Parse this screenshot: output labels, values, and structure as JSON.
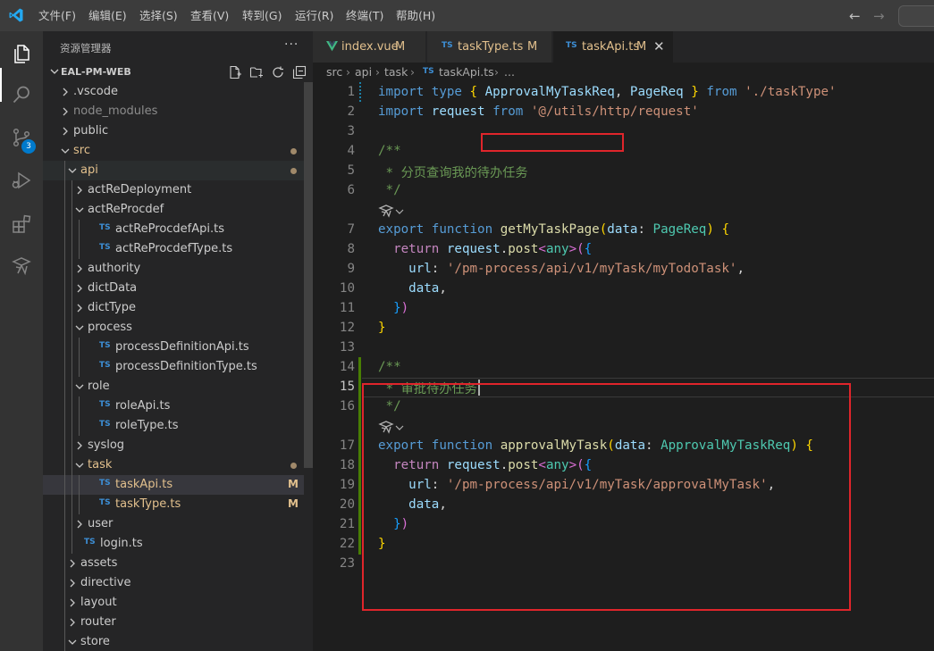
{
  "menu": [
    "文件(F)",
    "编辑(E)",
    "选择(S)",
    "查看(V)",
    "转到(G)",
    "运行(R)",
    "终端(T)",
    "帮助(H)"
  ],
  "activity_bar": {
    "icons": [
      "explorer-icon",
      "search-icon",
      "source-control-icon",
      "run-debug-icon",
      "extensions-icon",
      "vite-icon"
    ],
    "scm_badge": "3"
  },
  "sidebar": {
    "title": "资源管理器",
    "more": "···",
    "workspace": "EAL-PM-WEB",
    "tree": [
      {
        "label": ".vscode",
        "depth": 0,
        "type": "folder",
        "expanded": false
      },
      {
        "label": "node_modules",
        "depth": 0,
        "type": "folder",
        "expanded": false,
        "dim": true
      },
      {
        "label": "public",
        "depth": 0,
        "type": "folder",
        "expanded": false
      },
      {
        "label": "src",
        "depth": 0,
        "type": "folder",
        "expanded": true,
        "modified": true,
        "dot": true
      },
      {
        "label": "api",
        "depth": 1,
        "type": "folder",
        "expanded": true,
        "modified": true,
        "dot": true,
        "highlight": true
      },
      {
        "label": "actReDeployment",
        "depth": 2,
        "type": "folder",
        "expanded": false
      },
      {
        "label": "actReProcdef",
        "depth": 2,
        "type": "folder",
        "expanded": true
      },
      {
        "label": "actReProcdefApi.ts",
        "depth": 3,
        "type": "ts"
      },
      {
        "label": "actReProcdefType.ts",
        "depth": 3,
        "type": "ts"
      },
      {
        "label": "authority",
        "depth": 2,
        "type": "folder",
        "expanded": false
      },
      {
        "label": "dictData",
        "depth": 2,
        "type": "folder",
        "expanded": false
      },
      {
        "label": "dictType",
        "depth": 2,
        "type": "folder",
        "expanded": false
      },
      {
        "label": "process",
        "depth": 2,
        "type": "folder",
        "expanded": true
      },
      {
        "label": "processDefinitionApi.ts",
        "depth": 3,
        "type": "ts"
      },
      {
        "label": "processDefinitionType.ts",
        "depth": 3,
        "type": "ts"
      },
      {
        "label": "role",
        "depth": 2,
        "type": "folder",
        "expanded": true
      },
      {
        "label": "roleApi.ts",
        "depth": 3,
        "type": "ts"
      },
      {
        "label": "roleType.ts",
        "depth": 3,
        "type": "ts"
      },
      {
        "label": "syslog",
        "depth": 2,
        "type": "folder",
        "expanded": false
      },
      {
        "label": "task",
        "depth": 2,
        "type": "folder",
        "expanded": true,
        "modified": true,
        "dot": true
      },
      {
        "label": "taskApi.ts",
        "depth": 3,
        "type": "ts",
        "modified": true,
        "badge": "M",
        "selected": true
      },
      {
        "label": "taskType.ts",
        "depth": 3,
        "type": "ts",
        "modified": true,
        "badge": "M"
      },
      {
        "label": "user",
        "depth": 2,
        "type": "folder",
        "expanded": false
      },
      {
        "label": "login.ts",
        "depth": 2,
        "type": "ts",
        "flat": true
      },
      {
        "label": "assets",
        "depth": 1,
        "type": "folder",
        "expanded": false
      },
      {
        "label": "directive",
        "depth": 1,
        "type": "folder",
        "expanded": false
      },
      {
        "label": "layout",
        "depth": 1,
        "type": "folder",
        "expanded": false
      },
      {
        "label": "router",
        "depth": 1,
        "type": "folder",
        "expanded": false
      },
      {
        "label": "store",
        "depth": 1,
        "type": "folder",
        "expanded": true
      }
    ]
  },
  "tabs": [
    {
      "icon": "vue-icon",
      "label": "index.vue",
      "status": "M",
      "active": false
    },
    {
      "icon": "TS",
      "label": "taskType.ts",
      "status": "M",
      "active": false
    },
    {
      "icon": "TS",
      "label": "taskApi.ts",
      "status": "M",
      "active": true,
      "close": "✕"
    }
  ],
  "breadcrumb": {
    "parts": [
      "src",
      "api",
      "task"
    ],
    "file_icon": "TS",
    "file": "taskApi.ts",
    "tail": "..."
  },
  "editor": {
    "current_line": 15,
    "lines": [
      {
        "n": 1,
        "tokens": [
          [
            "kw",
            "import"
          ],
          [
            "pl",
            " "
          ],
          [
            "kw",
            "type"
          ],
          [
            "pl",
            " "
          ],
          [
            "b1",
            "{"
          ],
          [
            "pl",
            " "
          ],
          [
            "var",
            "ApprovalMyTaskReq"
          ],
          [
            "pl",
            ", "
          ],
          [
            "var",
            "PageReq"
          ],
          [
            "pl",
            " "
          ],
          [
            "b1",
            "}"
          ],
          [
            "pl",
            " "
          ],
          [
            "kw",
            "from"
          ],
          [
            "pl",
            " "
          ],
          [
            "str",
            "'./taskType'"
          ]
        ]
      },
      {
        "n": 2,
        "tokens": [
          [
            "kw",
            "import"
          ],
          [
            "pl",
            " "
          ],
          [
            "var",
            "request"
          ],
          [
            "pl",
            " "
          ],
          [
            "kw",
            "from"
          ],
          [
            "pl",
            " "
          ],
          [
            "str",
            "'@/utils/http/request'"
          ]
        ]
      },
      {
        "n": 3,
        "tokens": []
      },
      {
        "n": 4,
        "tokens": [
          [
            "cmt",
            "/**"
          ]
        ]
      },
      {
        "n": 5,
        "tokens": [
          [
            "cmt",
            " * 分页查询我的待办任务"
          ]
        ]
      },
      {
        "n": 6,
        "tokens": [
          [
            "cmt",
            " */"
          ]
        ]
      },
      {
        "n": 0,
        "codelens": true
      },
      {
        "n": 7,
        "tokens": [
          [
            "kw",
            "export"
          ],
          [
            "pl",
            " "
          ],
          [
            "kw",
            "function"
          ],
          [
            "pl",
            " "
          ],
          [
            "fn",
            "getMyTaskPage"
          ],
          [
            "b1",
            "("
          ],
          [
            "var",
            "data"
          ],
          [
            "pl",
            ": "
          ],
          [
            "ty",
            "PageReq"
          ],
          [
            "b1",
            ")"
          ],
          [
            "pl",
            " "
          ],
          [
            "b1",
            "{"
          ]
        ]
      },
      {
        "n": 8,
        "tokens": [
          [
            "pl",
            "  "
          ],
          [
            "ctl",
            "return"
          ],
          [
            "pl",
            " "
          ],
          [
            "var",
            "request"
          ],
          [
            "pl",
            "."
          ],
          [
            "fn",
            "post"
          ],
          [
            "b2",
            "<"
          ],
          [
            "ty",
            "any"
          ],
          [
            "b2",
            ">"
          ],
          [
            "b2",
            "("
          ],
          [
            "b3",
            "{"
          ]
        ]
      },
      {
        "n": 9,
        "tokens": [
          [
            "pl",
            "    "
          ],
          [
            "var",
            "url"
          ],
          [
            "pl",
            ": "
          ],
          [
            "str",
            "'/pm-process/api/v1/myTask/myTodoTask'"
          ],
          [
            "pl",
            ","
          ]
        ]
      },
      {
        "n": 10,
        "tokens": [
          [
            "pl",
            "    "
          ],
          [
            "var",
            "data"
          ],
          [
            "pl",
            ","
          ]
        ]
      },
      {
        "n": 11,
        "tokens": [
          [
            "pl",
            "  "
          ],
          [
            "b3",
            "}"
          ],
          [
            "b2",
            ")"
          ]
        ]
      },
      {
        "n": 12,
        "tokens": [
          [
            "b1",
            "}"
          ]
        ]
      },
      {
        "n": 13,
        "tokens": []
      },
      {
        "n": 14,
        "tokens": [
          [
            "cmt",
            "/**"
          ]
        ]
      },
      {
        "n": 15,
        "tokens": [
          [
            "cmt",
            " * 审批待办任务"
          ]
        ]
      },
      {
        "n": 16,
        "tokens": [
          [
            "cmt",
            " */"
          ]
        ]
      },
      {
        "n": 0,
        "codelens": true
      },
      {
        "n": 17,
        "tokens": [
          [
            "kw",
            "export"
          ],
          [
            "pl",
            " "
          ],
          [
            "kw",
            "function"
          ],
          [
            "pl",
            " "
          ],
          [
            "fn",
            "approvalMyTask"
          ],
          [
            "b1",
            "("
          ],
          [
            "var",
            "data"
          ],
          [
            "pl",
            ": "
          ],
          [
            "ty",
            "ApprovalMyTaskReq"
          ],
          [
            "b1",
            ")"
          ],
          [
            "pl",
            " "
          ],
          [
            "b1",
            "{"
          ]
        ]
      },
      {
        "n": 18,
        "tokens": [
          [
            "pl",
            "  "
          ],
          [
            "ctl",
            "return"
          ],
          [
            "pl",
            " "
          ],
          [
            "var",
            "request"
          ],
          [
            "pl",
            "."
          ],
          [
            "fn",
            "post"
          ],
          [
            "b2",
            "<"
          ],
          [
            "ty",
            "any"
          ],
          [
            "b2",
            ">"
          ],
          [
            "b2",
            "("
          ],
          [
            "b3",
            "{"
          ]
        ]
      },
      {
        "n": 19,
        "tokens": [
          [
            "pl",
            "    "
          ],
          [
            "var",
            "url"
          ],
          [
            "pl",
            ": "
          ],
          [
            "str",
            "'/pm-process/api/v1/myTask/approvalMyTask'"
          ],
          [
            "pl",
            ","
          ]
        ]
      },
      {
        "n": 20,
        "tokens": [
          [
            "pl",
            "    "
          ],
          [
            "var",
            "data"
          ],
          [
            "pl",
            ","
          ]
        ]
      },
      {
        "n": 21,
        "tokens": [
          [
            "pl",
            "  "
          ],
          [
            "b3",
            "}"
          ],
          [
            "b2",
            ")"
          ]
        ]
      },
      {
        "n": 22,
        "tokens": [
          [
            "b1",
            "}"
          ]
        ]
      },
      {
        "n": 23,
        "tokens": []
      }
    ]
  },
  "colors": {
    "accent": "#007acc",
    "modified": "#e2c08d",
    "annotation": "#e0252b",
    "git_added": "#487e02"
  }
}
